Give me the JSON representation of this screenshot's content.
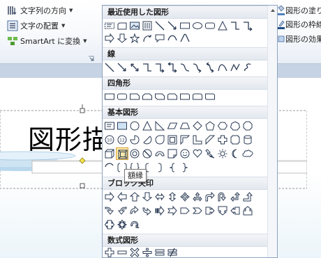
{
  "ribbon": {
    "text_direction_label": "文字列の方向",
    "align_text_label": "文字の配置",
    "smartart_label": "SmartArt に変換",
    "shape_fill_label": "図形の塗りつ",
    "shape_outline_label": "図形の枠線",
    "shape_effects_label": "図形の効果"
  },
  "slide": {
    "title_text": "図形描"
  },
  "gallery": {
    "sections": [
      {
        "id": "recent",
        "label": "最近使用した図形"
      },
      {
        "id": "lines",
        "label": "線"
      },
      {
        "id": "rectangles",
        "label": "四角形"
      },
      {
        "id": "basic",
        "label": "基本図形"
      },
      {
        "id": "block_arrows",
        "label": "ブロック矢印"
      },
      {
        "id": "equation",
        "label": "数式図形"
      }
    ],
    "selected_shape": "frame",
    "tooltip": "額縁"
  },
  "colors": {
    "shape_stroke": "#2b3b55",
    "header_bg": "#e3e8ef",
    "selected_bg": "#fce8a5",
    "handle_green": "#9bcf59",
    "handle_yellow": "#f4e44b",
    "slide_bg": "#c6d3e4"
  }
}
